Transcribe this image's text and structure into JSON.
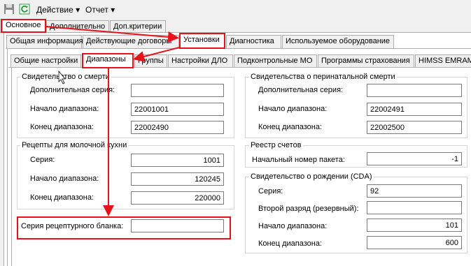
{
  "toolbar": {
    "save_icon": "floppy-disk-icon",
    "refresh_icon": "refresh-icon",
    "action_menu": "Действие",
    "report_menu": "Отчет",
    "dropdown_glyph": "▾"
  },
  "tabs_level1": [
    "Основное",
    "Дополнительно",
    "Доп.критерии"
  ],
  "tabs_level2": [
    "Общая информация",
    "Действующие договоры",
    "Установки",
    "Диагностика",
    "Используемое оборудование"
  ],
  "tabs_level3": [
    "Общие настройки",
    "Диапазоны",
    "Группы",
    "Настройки ДЛО",
    "Подконтрольные МО",
    "Программы страхования",
    "HIMSS EMRAM"
  ],
  "death_cert": {
    "title": "Свидетельство о смерти",
    "extra_series_label": "Дополнительная серия:",
    "extra_series_value": "",
    "range_start_label": "Начало диапазона:",
    "range_start_value": "22001001",
    "range_end_label": "Конец диапазона:",
    "range_end_value": "22002490"
  },
  "perinatal_cert": {
    "title": "Свидетельства о перинатальной смерти",
    "extra_series_label": "Дополнительная серия:",
    "extra_series_value": "",
    "range_start_label": "Начало диапазона:",
    "range_start_value": "22002491",
    "range_end_label": "Конец диапазона:",
    "range_end_value": "22002500"
  },
  "milk_kitchen": {
    "title": "Рецепты для молочной кухни",
    "series_label": "Серия:",
    "series_value": "1001",
    "range_start_label": "Начало диапазона:",
    "range_start_value": "120245",
    "range_end_label": "Конец диапазона:",
    "range_end_value": "220000"
  },
  "invoice_registry": {
    "title": "Реестр счетов",
    "packet_label": "Начальный номер пакета:",
    "packet_value": "-1"
  },
  "birth_cert": {
    "title": "Свидетельство о рождении (CDA)",
    "series_label": "Серия:",
    "series_value": "92",
    "second_digit_label": "Второй разряд (резервный):",
    "second_digit_value": "",
    "range_start_label": "Начало диапазона:",
    "range_start_value": "101",
    "range_end_label": "Конец диапазона:",
    "range_end_value": "600"
  },
  "recipe_blank": {
    "label": "Серия рецептурного бланка:",
    "value": ""
  },
  "colors": {
    "highlight": "#e8101a",
    "refresh_green": "#2e9b3a"
  }
}
